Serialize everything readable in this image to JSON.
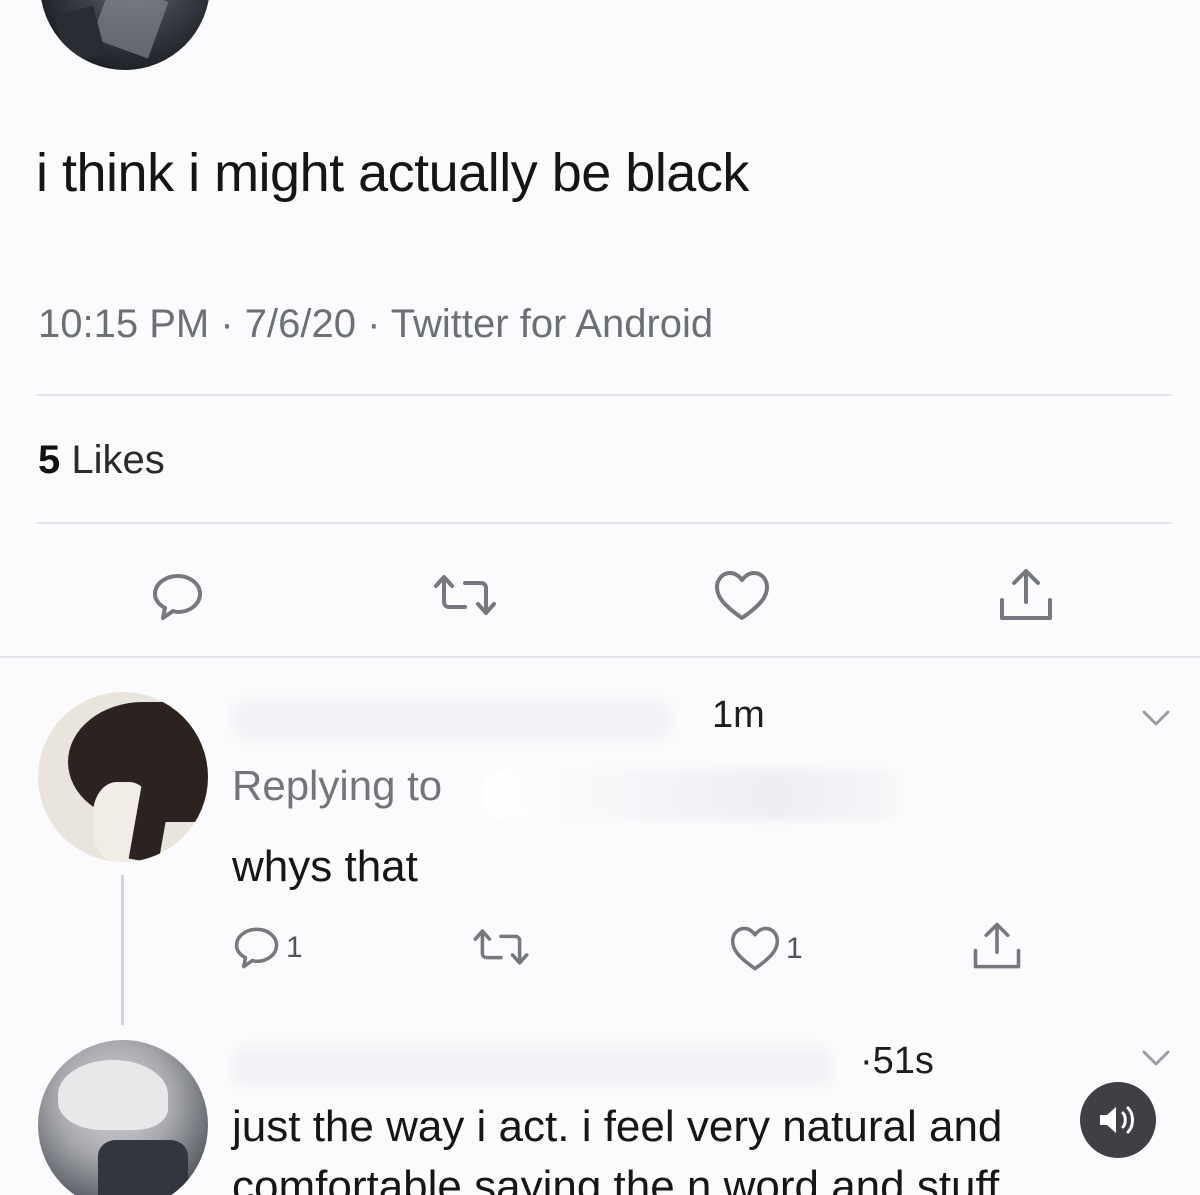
{
  "tweet": {
    "text": "i think i might actually be black",
    "meta": "10:15 PM · 7/6/20 · Twitter for Android",
    "likes_count": "5",
    "likes_label": "Likes",
    "actions": [
      "reply-icon",
      "retweet-icon",
      "like-icon",
      "share-icon"
    ]
  },
  "replies": [
    {
      "time": "1m",
      "replying_to": "Replying to",
      "text": "whys that",
      "reply_count": "1",
      "like_count": "1"
    },
    {
      "time": "·51s",
      "text_line1": "just the way i act. i feel very natural and",
      "text_line2": "comfortable saying the n word and stuff"
    }
  ],
  "colors": {
    "background": "#fbfbfd",
    "text": "#151515",
    "secondary_text": "#6b6f76",
    "icon": "#75787f",
    "divider": "#e4e5ea",
    "sound_button": "#3f3f44"
  }
}
